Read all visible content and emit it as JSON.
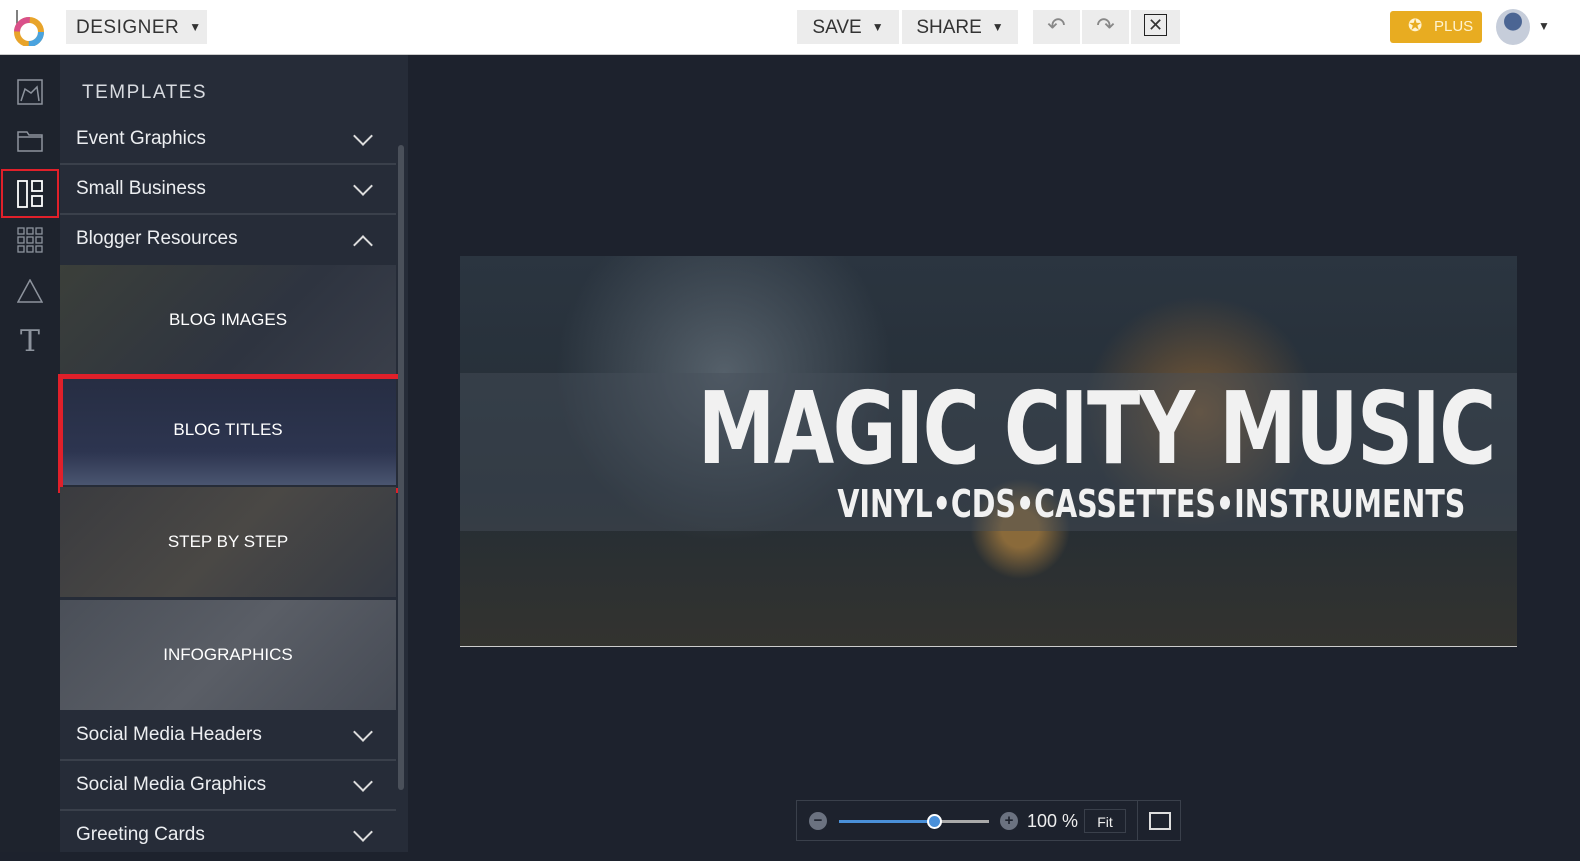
{
  "topbar": {
    "mode": "DESIGNER",
    "save": "SAVE",
    "share": "SHARE",
    "plus": "PLUS"
  },
  "panel": {
    "title": "TEMPLATES",
    "sections": [
      "Event Graphics",
      "Small Business",
      "Blogger Resources"
    ],
    "tiles": [
      "BLOG IMAGES",
      "BLOG TITLES",
      "STEP BY STEP",
      "INFOGRAPHICS"
    ],
    "sections_after": [
      "Social Media Headers",
      "Social Media Graphics",
      "Greeting Cards"
    ]
  },
  "canvas": {
    "title": "MAGIC CITY MUSIC",
    "subtitle": "VINYL•CDS•CASSETTES•INSTRUMENTS"
  },
  "zoom": {
    "level": "100 %",
    "percent": 100,
    "fit": "Fit"
  },
  "colors": {
    "highlight": "#e0202a",
    "plus": "#e8ac21",
    "slider": "#4a90d9"
  }
}
